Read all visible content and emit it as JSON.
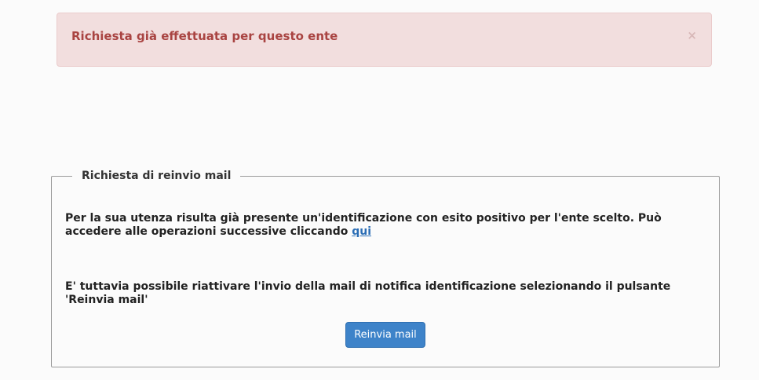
{
  "alert": {
    "message": "Richiesta già effettuata per questo ente",
    "close_symbol": "×",
    "close_icon": "close-icon"
  },
  "fieldset": {
    "legend": "Richiesta di reinvio mail",
    "paragraph1": {
      "text": "Per la sua utenza risulta già presente un'identificazione con esito positivo per l'ente scelto. Può accedere alle operazioni successive cliccando ",
      "link_label": "qui"
    },
    "paragraph2": "E' tuttavia possibile riattivare l'invio della mail di notifica identificazione selezionando il pulsante 'Reinvia mail'",
    "button_label": "Reinvia mail"
  },
  "colors": {
    "alert_background": "#f2dede",
    "alert_text": "#a94442",
    "link": "#2a6db5",
    "button": "#3e83c9"
  }
}
